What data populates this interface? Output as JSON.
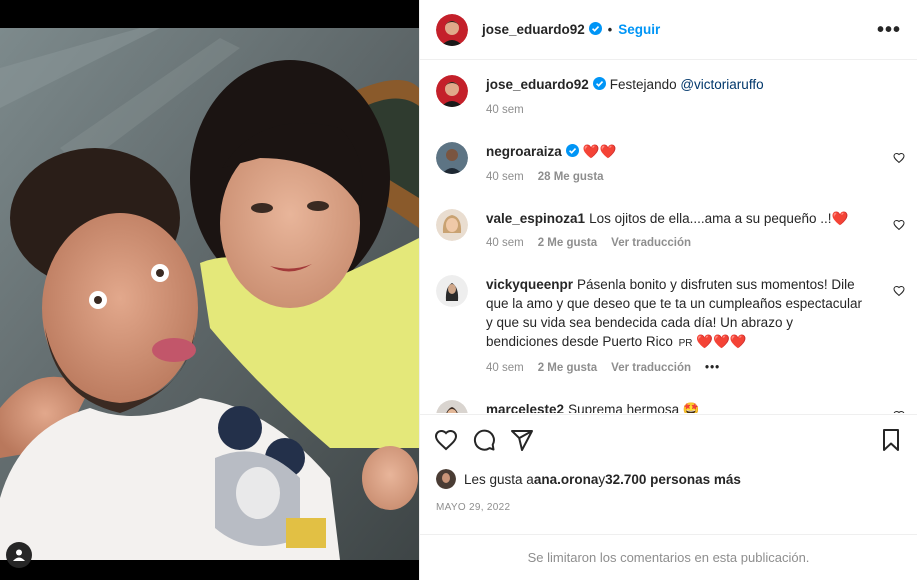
{
  "post": {
    "author": {
      "username": "jose_eduardo92",
      "avatar_icon": "profile-photo",
      "verified": true
    },
    "follow_label": "Seguir",
    "separator": "•",
    "more_label": "•••",
    "caption": {
      "username": "jose_eduardo92",
      "text": "Festejando ",
      "mention": "@victoriaruffo",
      "time": "40 sem"
    },
    "comments": [
      {
        "username": "negroaraiza",
        "verified": true,
        "text": "",
        "emoji": "❤️❤️",
        "time": "40 sem",
        "likes": "28 Me gusta",
        "translate": ""
      },
      {
        "username": "vale_espinoza1",
        "verified": false,
        "text": "Los ojitos de ella....ama a su pequeño ..!",
        "emoji": "❤️",
        "time": "40 sem",
        "likes": "2 Me gusta",
        "translate": "Ver traducción"
      },
      {
        "username": "vickyqueenpr",
        "verified": false,
        "text": "Pásenla bonito y disfruten sus momentos! Dile que la amo y que deseo que te ta un cumpleaños espectacular y que su vida sea bendecida cada día! Un abrazo y bendiciones desde Puerto Rico",
        "flag": "PR",
        "emoji": "❤️❤️❤️",
        "time": "40 sem",
        "likes": "2 Me gusta",
        "translate": "Ver traducción",
        "more": "•••"
      },
      {
        "username": "marceleste2",
        "verified": false,
        "text": "Suprema hermosa",
        "emoji": "🤩",
        "time": "",
        "likes": "",
        "translate": ""
      }
    ],
    "likes": {
      "prefix": "Les gusta a ",
      "user": "ana.orona",
      "middle": " y ",
      "count": "32.700 personas más"
    },
    "date": "MAYO 29, 2022",
    "comments_disabled": "Se limitaron los comentarios en esta publicación.",
    "colors": {
      "accent": "#0095f6",
      "muted": "#8e8e8e",
      "text": "#262626",
      "heart": "#ed4956"
    }
  }
}
